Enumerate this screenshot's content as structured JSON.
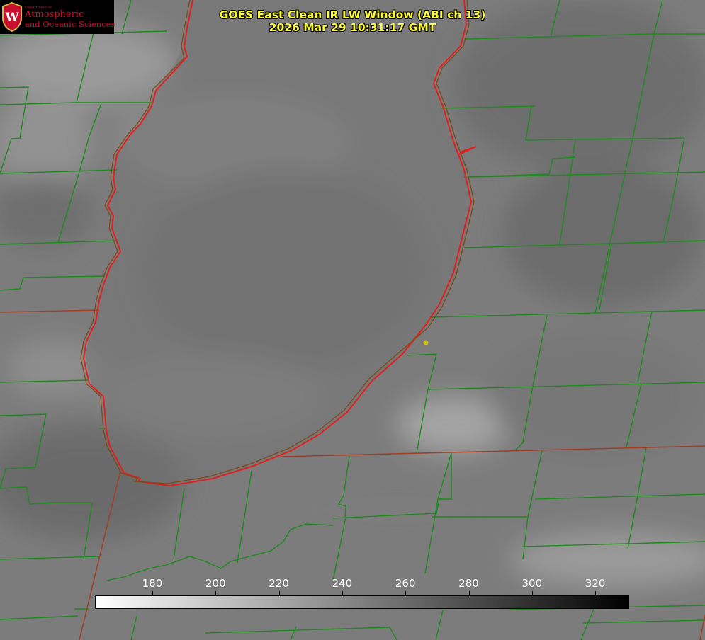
{
  "logo": {
    "department": "Department of",
    "line1": "Atmospheric",
    "line2": "and Oceanic Sciences",
    "seal_letter": "W",
    "color": "#c8102e"
  },
  "title": {
    "line1": "GOES East Clean IR LW Window (ABI ch 13)",
    "line2": "2026 Mar 29 10:31:17 GMT",
    "color": "#ffff33"
  },
  "colorbar": {
    "ticks": [
      "180",
      "200",
      "220",
      "240",
      "260",
      "280",
      "300",
      "320"
    ],
    "gradient_start": "#ffffff",
    "gradient_end": "#000000"
  },
  "colors": {
    "boundary_county": "#1f8a1f",
    "boundary_state": "#a0402a",
    "coastline": "#e02020",
    "marker": "#d4c21a"
  },
  "icons": {
    "seal": "uw-crest-icon",
    "marker": "location-dot-icon"
  }
}
